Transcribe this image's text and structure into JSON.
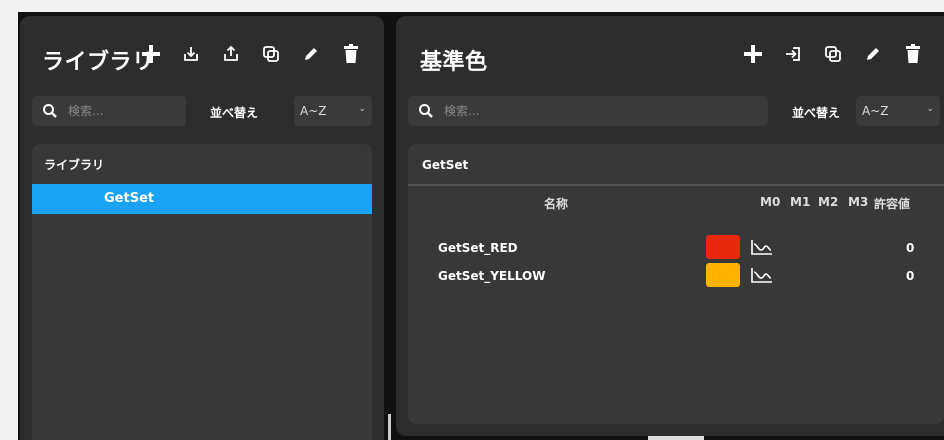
{
  "library": {
    "title": "ライブラリ",
    "search_placeholder": "検索...",
    "sort_label": "並べ替え",
    "sort_value": "A~Z",
    "tree_header": "ライブラリ",
    "selected_item": "GetSet",
    "toolbar_icons": [
      "plus-icon",
      "import-icon",
      "export-icon",
      "duplicate-icon",
      "pencil-icon",
      "trash-icon"
    ]
  },
  "reference_colors": {
    "title": "基準色",
    "search_placeholder": "検索...",
    "sort_label": "並べ替え",
    "sort_value": "A~Z",
    "group_name": "GetSet",
    "columns": {
      "name": "名称",
      "m0": "M0",
      "m1": "M1",
      "m2": "M2",
      "m3": "M3",
      "tolerance": "許容値"
    },
    "rows": [
      {
        "name": "GetSet_RED",
        "color": "#e8280c",
        "tolerance": "0"
      },
      {
        "name": "GetSet_YELLOW",
        "color": "#ffb300",
        "tolerance": "0"
      }
    ],
    "toolbar_icons": [
      "plus-icon",
      "login-icon",
      "duplicate-icon",
      "pencil-icon",
      "trash-icon"
    ]
  },
  "colors": {
    "selection": "#1aa3f5",
    "panel": "#2d2d2d"
  }
}
